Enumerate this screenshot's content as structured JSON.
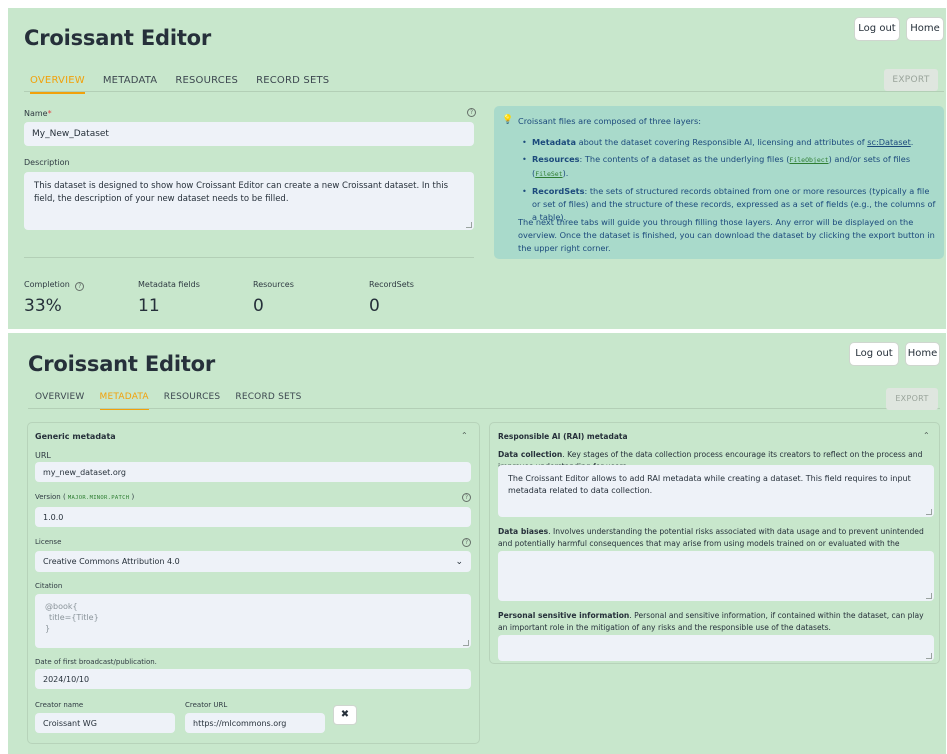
{
  "app": {
    "title": "Croissant Editor",
    "logout": "Log out",
    "home": "Home",
    "export": "EXPORT"
  },
  "tabs": [
    "OVERVIEW",
    "METADATA",
    "RESOURCES",
    "RECORD SETS"
  ],
  "overview": {
    "name_label": "Name",
    "name_required_mark": "*",
    "name_value": "My_New_Dataset",
    "description_label": "Description",
    "description_value": "This dataset is designed to show how Croissant Editor can create a new Croissant dataset. In this field, the description of your new dataset needs to be filled.",
    "stats": [
      {
        "label": "Completion",
        "value": "33%"
      },
      {
        "label": "Metadata fields",
        "value": "11"
      },
      {
        "label": "Resources",
        "value": "0"
      },
      {
        "label": "RecordSets",
        "value": "0"
      }
    ],
    "info": {
      "intro": "Croissant files are composed of three layers:",
      "metadata_term": "Metadata",
      "metadata_text": " about the dataset covering Responsible AI, licensing and attributes of ",
      "metadata_link": "sc:Dataset",
      "resources_term": "Resources",
      "resources_text_1": ": The contents of a dataset as the underlying files (",
      "resources_code_1": "FileObject",
      "resources_text_2": ") and/or sets of files (",
      "resources_code_2": "FileSet",
      "resources_text_3": ").",
      "recordsets_term": "RecordSets",
      "recordsets_text": ": the sets of structured records obtained from one or more resources (typically a file or set of files) and the structure of these records, expressed as a set of fields (e.g., the columns of a table).",
      "footer": "The next three tabs will guide you through filling those layers. Any error will be displayed on the overview. Once the dataset is finished, you can download the dataset by clicking the export button in the upper right corner."
    }
  },
  "metadata": {
    "generic_title": "Generic metadata",
    "url_label": "URL",
    "url_value": "my_new_dataset.org",
    "version_label_pre": "Version ( ",
    "version_code": "MAJOR.MINOR.PATCH",
    "version_label_post": " )",
    "version_value": "1.0.0",
    "license_label": "License",
    "license_value": "Creative Commons Attribution 4.0",
    "citation_label": "Citation",
    "citation_placeholder_1": "@book{",
    "citation_placeholder_2": "title={Title}",
    "citation_placeholder_3": "}",
    "date_label": "Date of first broadcast/publication.",
    "date_value": "2024/10/10",
    "creator_name_label": "Creator name",
    "creator_name_value": "Croissant WG",
    "creator_url_label": "Creator URL",
    "creator_url_value": "https://mlcommons.org",
    "remove_symbol": "✖"
  },
  "rai": {
    "title": "Responsible AI (RAI) metadata",
    "collection_term": "Data collection",
    "collection_text": ". Key stages of the data collection process encourage its creators to reflect on the process and improves understanding for users.",
    "collection_value": "The Croissant Editor allows to add RAI metadata while creating a dataset. This field requires to input metadata related to data collection.",
    "biases_term": "Data biases",
    "biases_text": ". Involves understanding the potential risks associated with data usage and to prevent unintended and potentially harmful consequences that may arise from using models trained on or evaluated with the respective data.",
    "sensitive_term": "Personal sensitive information",
    "sensitive_text": ". Personal and sensitive information, if contained within the dataset, can play an important role in the mitigation of any risks and the responsible use of the datasets."
  }
}
